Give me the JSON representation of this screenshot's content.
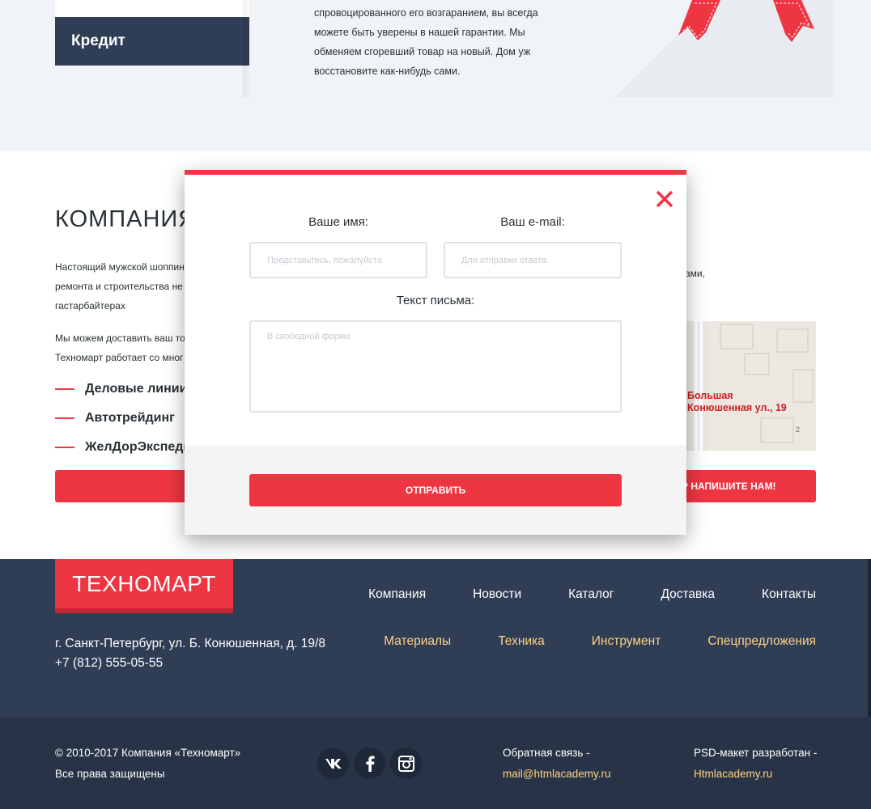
{
  "top": {
    "tab_label": "Кредит",
    "guarantee_lines": [
      "спровоцированного его возгаранием, вы всегда",
      "можете быть уверены в нашей гарантии. Мы",
      "обменяем сгоревший товар на новый. Дом уж",
      "восстановите как-нибудь сами."
    ]
  },
  "company": {
    "title": "КОМПАНИЯ «Т",
    "text_lines": [
      "Настоящий мужской шоппин",
      "ремонта и строительства не",
      "гастарбайтерах"
    ],
    "delivery_lines": [
      "Мы можем доставить ваш то",
      "Техномарт работает со мног"
    ],
    "right_text": "сами,",
    "partners": [
      "Деловые линии",
      "Автотрейдинг",
      "ЖелДорЭкспеди"
    ],
    "write_us_label": "Р НАПИШИТЕ НАМ!",
    "map_label_line1": "Большая",
    "map_label_line2": "Конюшенная ул., 19",
    "map_house_number": "2"
  },
  "modal": {
    "name_label": "Ваше имя:",
    "name_placeholder": "Представьтесь, пожалуйста",
    "email_label": "Ваш e-mail:",
    "email_placeholder": "Для отправки ответа",
    "message_label": "Текст письма:",
    "message_placeholder": "В свободной форме",
    "submit_label": "ОТПРАВИТЬ",
    "close_icon": "close-icon",
    "accent_color": "#ee3643"
  },
  "footer": {
    "logo": "ТЕХНОМАРТ",
    "nav_main": [
      "Компания",
      "Новости",
      "Каталог",
      "Доставка",
      "Контакты"
    ],
    "nav_catalog": [
      "Материалы",
      "Техника",
      "Инструмент",
      "Спецпредложения"
    ],
    "address_line1": "г. Санкт-Петербург, ул. Б. Конюшенная, д. 19/8",
    "address_line2": "+7 (812) 555-05-55",
    "copyright_line1": "© 2010-2017 Компания «Техномарт»",
    "copyright_line2": "Все права защищены",
    "socials": [
      "vk-icon",
      "facebook-icon",
      "instagram-icon"
    ],
    "feedback_label": "Обратная связь -",
    "feedback_email": "mail@htmlacademy.ru",
    "psd_label": "PSD-макет разработан -",
    "psd_link": "Htmlacademy.ru",
    "bg_color": "#2f3d55",
    "link_color": "#ffd283"
  }
}
